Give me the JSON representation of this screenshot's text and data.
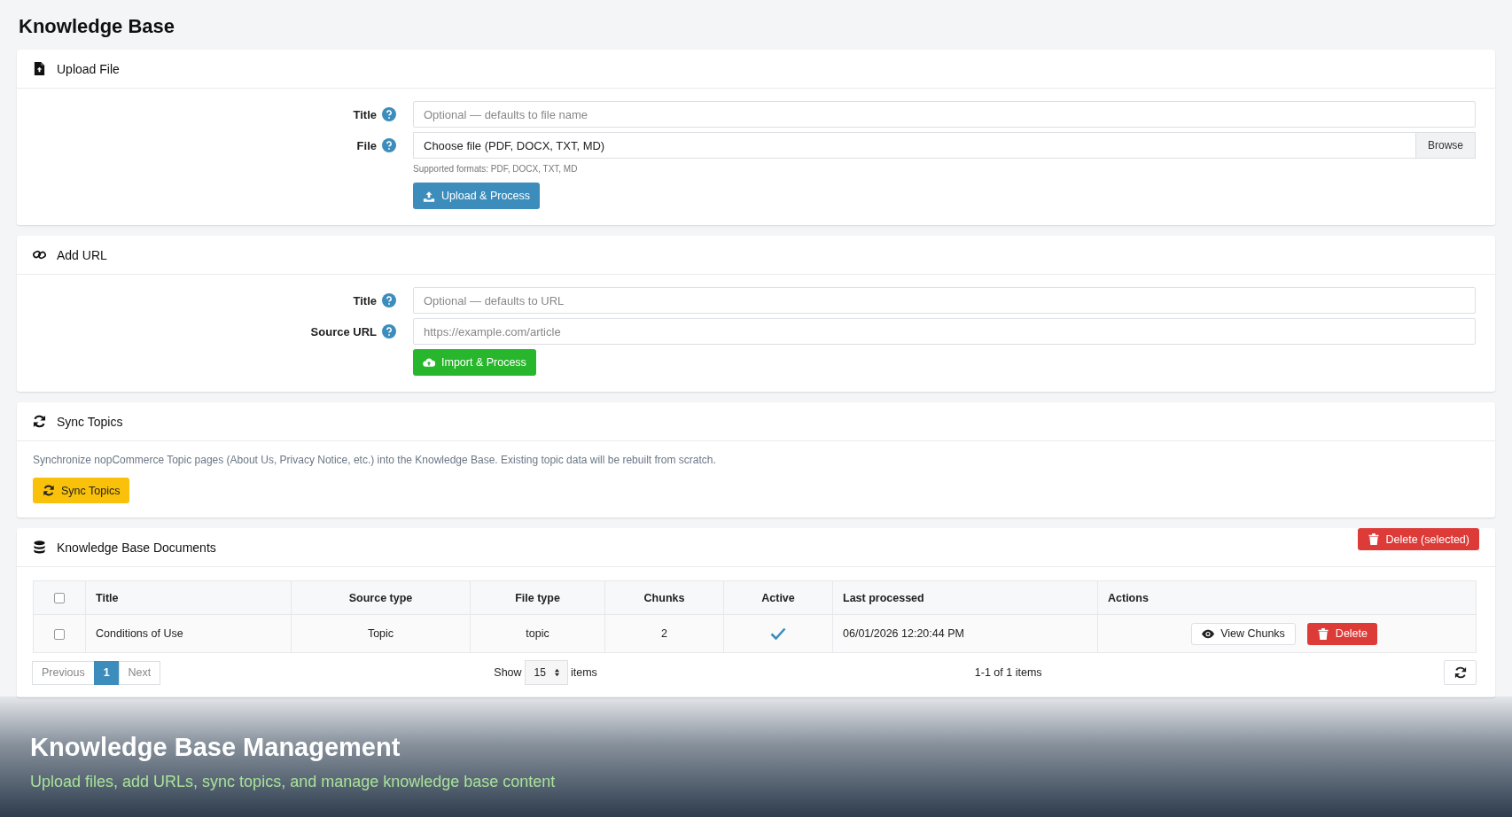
{
  "page_title": "Knowledge Base",
  "upload": {
    "title": "Upload File",
    "fields": [
      {
        "kind": "text",
        "label": "Title",
        "placeholder": "Optional — defaults to file name"
      },
      {
        "kind": "file",
        "label": "File",
        "value": "Choose file (PDF, DOCX, TXT, MD)",
        "button": "Browse",
        "hint": "Supported formats: PDF, DOCX, TXT, MD"
      }
    ],
    "submit": "Upload & Process"
  },
  "add_url": {
    "title": "Add URL",
    "fields": [
      {
        "kind": "text",
        "label": "Title",
        "placeholder": "Optional — defaults to URL"
      },
      {
        "kind": "text",
        "label": "Source URL",
        "placeholder": "https://example.com/article"
      }
    ],
    "submit": "Import & Process"
  },
  "sync": {
    "title": "Sync Topics",
    "description": "Synchronize nopCommerce Topic pages (About Us, Privacy Notice, etc.) into the Knowledge Base. Existing topic data will be rebuilt from scratch.",
    "button": "Sync Topics"
  },
  "documents": {
    "title": "Knowledge Base Documents",
    "delete_selected": "Delete (selected)",
    "select_all": {
      "checked": false
    },
    "columns": [
      "Title",
      "Source type",
      "File type",
      "Chunks",
      "Active",
      "Last processed",
      "Actions"
    ],
    "rows": [
      {
        "checked": false,
        "title": "Conditions of Use",
        "source_type": "Topic",
        "file_type": "topic",
        "chunks": "2",
        "active": true,
        "last_processed": "06/01/2026 12:20:44 PM",
        "actions": [
          "View Chunks",
          "Delete"
        ]
      }
    ],
    "pagination": {
      "previous": "Previous",
      "pages": [
        {
          "label": "1",
          "selected": true
        }
      ],
      "next": "Next"
    },
    "show": {
      "label": "Show",
      "value": "15",
      "suffix": "items"
    },
    "summary": "1-1 of 1 items"
  },
  "caption": {
    "title": "Knowledge Base Management",
    "subtitle": "Upload files, add URLs, sync topics, and manage knowledge base content"
  }
}
